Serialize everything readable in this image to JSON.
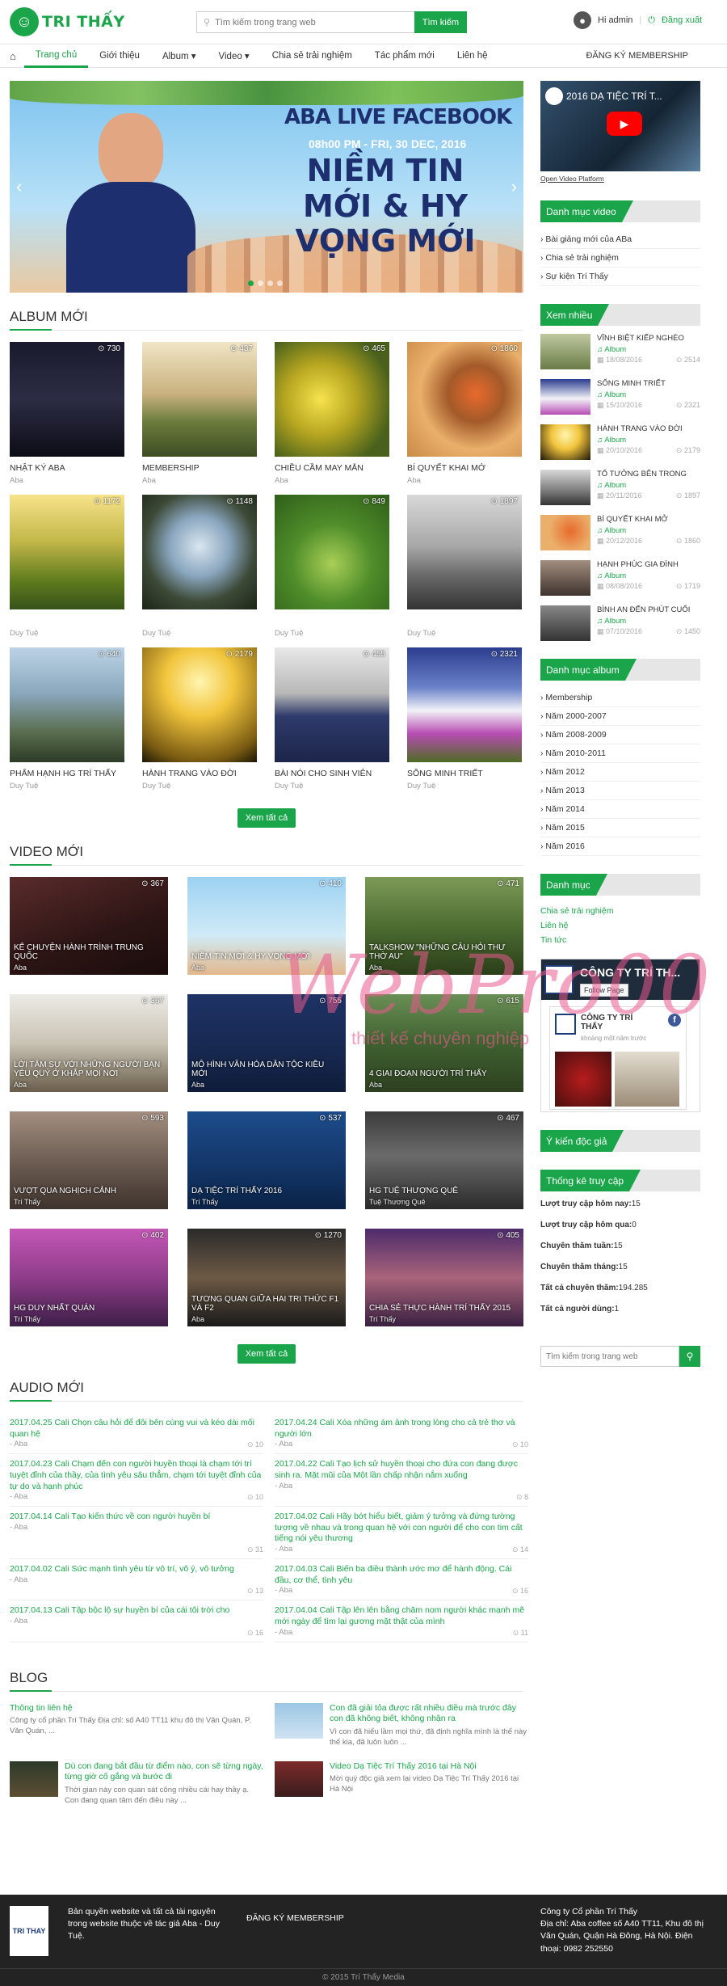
{
  "header": {
    "logo_text": "TRI THẤY",
    "search_placeholder": "Tìm kiếm trong trang web",
    "search_button": "Tìm kiếm",
    "user_greeting": "Hi admin",
    "separator": "|",
    "logout": "Đăng xuất"
  },
  "nav": {
    "items": [
      "Trang chủ",
      "Giới thiệu",
      "Album ▾",
      "Video ▾",
      "Chia sẻ trải nghiệm",
      "Tác phẩm mới",
      "Liên hệ"
    ],
    "membership": "ĐĂNG KÝ MEMBERSHIP"
  },
  "banner": {
    "title1": "ABA LIVE FACEBOOK",
    "title2": "08h00 PM - FRI, 30 DEC, 2016",
    "title3": "NIỀM TIN MỚI & HY VỌNG MỚI"
  },
  "albums": {
    "title": "ALBUM MỚI",
    "items": [
      {
        "name": "NHẬT KÝ ABA",
        "author": "Aba",
        "views": "730",
        "bg": "linear-gradient(180deg,#1a1a2e,#2c2c44 50%,#0d0d16)"
      },
      {
        "name": "MEMBERSHIP",
        "author": "Aba",
        "views": "437",
        "bg": "linear-gradient(180deg,#f0e5c6,#c9b27f 45%,#6a7b3c 70%,#3f4d23)"
      },
      {
        "name": "CHIỀU CẦM MAY MẮN",
        "author": "Aba",
        "views": "465",
        "bg": "radial-gradient(circle at 40% 50%,#f7e34d,#b6a520 40%,#49611c 80%)"
      },
      {
        "name": "BÍ QUYẾT KHAI MỞ",
        "author": "Aba",
        "views": "1860",
        "bg": "radial-gradient(circle at 60% 45%,#e86a2d,#a35a29 30%,#eab06b 60%,#c98a46)"
      },
      {
        "name": "",
        "author": "Duy Tuệ",
        "views": "1172",
        "bg": "linear-gradient(180deg,#f7e38a,#c4b84a 40%,#5f7c1d 75%,#37521a)"
      },
      {
        "name": "",
        "author": "Duy Tuệ",
        "views": "1148",
        "bg": "radial-gradient(circle at 50% 45%,#d9e6ef,#8aa6bf 35%,#3d4a38 65%,#1c2516)"
      },
      {
        "name": "",
        "author": "Duy Tuệ",
        "views": "849",
        "bg": "radial-gradient(circle at 50% 60%,#a9cf57,#4f8d2a 45%,#2e5e19)"
      },
      {
        "name": "",
        "author": "Duy Tuệ",
        "views": "1897",
        "bg": "linear-gradient(180deg,#d9d9d9,#a7a7a7 45%,#6a6a6a 70%,#333)"
      },
      {
        "name": "PHẨM HẠNH HG TRÍ THẤY",
        "author": "Duy Tuệ",
        "views": "640",
        "bg": "linear-gradient(180deg,#bcd3e6,#8aa7bc 40%,#586b4c 75%,#2c3b27)"
      },
      {
        "name": "HÀNH TRANG VÀO ĐỜI",
        "author": "Duy Tuệ",
        "views": "2179",
        "bg": "radial-gradient(circle at 50% 30%,#fff5b0,#f2c53d 35%,#7a5b12 80%,#1c1606)"
      },
      {
        "name": "BÀI NÓI CHO SINH VIÊN",
        "author": "Duy Tuệ",
        "views": "455",
        "bg": "linear-gradient(180deg,#e8e8e8,#b8b8b8 40%,#2e3a6a 60%,#1c254a)"
      },
      {
        "name": "SỐNG MINH TRIẾT",
        "author": "Duy Tuệ",
        "views": "2321",
        "bg": "linear-gradient(180deg,#2b3d8f,#6b82c9 35%,#f2f2f7 55%,#b74db3 75%,#4f6b24)"
      }
    ],
    "view_all": "Xem tất cả"
  },
  "videos": {
    "title": "VIDEO MỚI",
    "items": [
      {
        "name": "KỂ CHUYỆN HÀNH TRÌNH TRUNG QUỐC",
        "author": "Aba",
        "views": "367",
        "bg": "linear-gradient(160deg,#5a2b2b,#2c1414 60%,#1a0c0c)"
      },
      {
        "name": "NIỀM TIN MỚI & HY VỌNG MỚI",
        "author": "Aba",
        "views": "410",
        "bg": "linear-gradient(180deg,#9dd2f2,#d0eaf7 60%,#e3b88c)"
      },
      {
        "name": "TALKSHOW \"NHỮNG CÂU HỎI THƯ THỜ AU\"",
        "author": "Aba",
        "views": "471",
        "bg": "linear-gradient(180deg,#7d9a58,#4d6d31 50%,#2a3e1a)"
      },
      {
        "name": "LỜI TÂM SỰ VỚI NHỮNG NGƯỜI BẠN YÊU QUÝ Ở KHẮP MỌI NƠI",
        "author": "Aba",
        "views": "367",
        "bg": "linear-gradient(180deg,#ecebe6,#c9c3b4 50%,#6a5e4b)"
      },
      {
        "name": "MÔ HÌNH VĂN HÓA DÂN TỘC KIỀU MỚI",
        "author": "Aba",
        "views": "755",
        "bg": "linear-gradient(180deg,#1e3365,#17284f 60%,#0f1c3a)"
      },
      {
        "name": "4 GIAI ĐOẠN NGƯỜI TRÍ THẤY",
        "author": "Aba",
        "views": "615",
        "bg": "linear-gradient(180deg,#6a8f55,#3f6130 50%,#2d4020)"
      },
      {
        "name": "VƯỢT QUA NGHỊCH CẢNH",
        "author": "Trí Thấy",
        "views": "593",
        "bg": "linear-gradient(180deg,#a38e80,#6a5a50 55%,#3e332d)"
      },
      {
        "name": "DẠ TIỆC TRÍ THẤY 2016",
        "author": "Trí Thấy",
        "views": "537",
        "bg": "linear-gradient(180deg,#1d4c8c,#123566 60%,#0b2246)"
      },
      {
        "name": "HG Tuệ Thượng Quê",
        "author": "Tuệ Thương Quê",
        "views": "467",
        "bg": "linear-gradient(180deg,#3b3b3b,#6b6b6b 45%,#2a2a2a)"
      },
      {
        "name": "HG Duy Nhất Quán",
        "author": "Trí Thấy",
        "views": "402",
        "bg": "linear-gradient(180deg,#c457b6,#8f3d8a 50%,#3e1f48)"
      },
      {
        "name": "Tương quan giữa hai tri thức F1 và F2",
        "author": "Aba",
        "views": "1270",
        "bg": "linear-gradient(180deg,#2a2a2a,#6d5a45 50%,#1a1a1a)"
      },
      {
        "name": "Chia sẻ thực hành Trí Thấy 2015",
        "author": "Trí Thấy",
        "views": "405",
        "bg": "linear-gradient(180deg,#4d2b6b,#a9647a 50%,#3a2042)"
      }
    ],
    "view_all": "Xem tất cả"
  },
  "audio": {
    "title": "AUDIO MỚI",
    "items": [
      {
        "title": "2017.04.25 Cali Chọn câu hỏi để đôi bên cùng vui và kéo dài mối quan hệ",
        "author": "- Aba",
        "count": "10"
      },
      {
        "title": "2017.04.24 Cali Xóa những ám ảnh trong lòng cho cả trẻ thơ và người lớn",
        "author": "- Aba",
        "count": "10"
      },
      {
        "title": "2017.04.23 Cali Chạm đến con người huyền thoại là chạm tới trí tuyệt đỉnh của thầy, của tình yêu sâu thẳm, chạm tới tuyệt đỉnh của tự do và hạnh phúc",
        "author": "- Aba",
        "count": "10"
      },
      {
        "title": "2017.04.22 Cali Tạo lịch sử huyền thoại cho đứa con đang được sinh ra. Mặt mũi của Một lần chấp nhận nắm xuống",
        "author": "- Aba",
        "count": "8"
      },
      {
        "title": "2017.04.14 Cali Tạo kiến thức về con người huyền bí",
        "author": "- Aba",
        "count": "31"
      },
      {
        "title": "2017.04.02 Cali Hãy bớt hiểu biết, giảm ý tưởng và đứng tường tượng về nhau và trong quan hệ với con người để cho con tim cất tiếng nói yêu thương",
        "author": "- Aba",
        "count": "14"
      },
      {
        "title": "2017.04.02 Cali Sức mạnh tình yêu từ vô trí, vô ý, vô tưởng",
        "author": "- Aba",
        "count": "13"
      },
      {
        "title": "2017.04.03 Cali Biến ba điều thành ước mơ để hành động. Cái đầu, cơ thể, tình yêu",
        "author": "- Aba",
        "count": "16"
      },
      {
        "title": "2017.04.13 Cali Tập bộc lộ sự huyền bí của cái tôi trời cho",
        "author": "- Aba",
        "count": "16"
      },
      {
        "title": "2017.04.04 Cali Tập lên lên bằng chăm nom người khác mạnh mẽ mới ngày để tìm lại gương mặt thật của mình",
        "author": "- Aba",
        "count": "11"
      }
    ]
  },
  "blog": {
    "title": "BLOG",
    "items": [
      {
        "title": "Thông tin liên hệ",
        "desc": "Công ty cổ phần Trí Thấy Địa chỉ: số A40 TT11 khu đô thị Văn Quán, P. Văn Quán, ...",
        "img": ""
      },
      {
        "title": "Con đã giải tỏa được rất nhiều điều mà trước đây con đã không biết, không nhận ra",
        "desc": "Vì con đã hiểu lầm mọi thứ, đã định nghĩa mình là thế này thế kia, đã luôn luôn ...",
        "img": "linear-gradient(180deg,#9cc6e4,#cfe3f2)"
      },
      {
        "title": "Dù con đang bắt đầu từ điểm nào, con sẽ từng ngày, từng giờ cố gắng và bước đi",
        "desc": "Thời gian này con quan sát công nhiều cái hay thầy ạ. Con đang quan tâm đến điều này ...",
        "img": "linear-gradient(180deg,#2d3a2a,#5d4f33)"
      },
      {
        "title": "Video Dạ Tiệc Trí Thấy 2016 tại Hà Nội",
        "desc": "Mời quý độc giả xem lại video Dạ Tiệc Trí Thấy 2016 tại Hà Nội",
        "img": "linear-gradient(180deg,#7d2b2b,#3a1d1d)"
      }
    ]
  },
  "sidebar": {
    "youtube_title": "2016 DẠ TIỆC TRÍ T...",
    "youtube_link": "Open Video Platform",
    "video_cat_title": "Danh mục video",
    "video_cats": [
      "Bài giảng mới của ABa",
      "Chia sẻ trải nghiệm",
      "Sự kiện Trí Thấy"
    ],
    "popular_title": "Xem nhiều",
    "popular": [
      {
        "title": "VĨNH BIỆT KIẾP NGHÈO",
        "cat": "Album",
        "date": "18/08/2016",
        "views": "2514",
        "img": "linear-gradient(180deg,#bfc9a0,#6a7c47)"
      },
      {
        "title": "SỐNG MINH TRIẾT",
        "cat": "Album",
        "date": "15/10/2016",
        "views": "2321",
        "img": "linear-gradient(180deg,#2b3d8f,#f2f2f7 55%,#b74db3)"
      },
      {
        "title": "HÀNH TRANG VÀO ĐỜI",
        "cat": "Album",
        "date": "20/10/2016",
        "views": "2179",
        "img": "radial-gradient(circle at 50% 30%,#fff5b0,#f2c53d 40%,#1c1606)"
      },
      {
        "title": "TỔ TƯỞNG BÊN TRONG",
        "cat": "Album",
        "date": "20/11/2016",
        "views": "1897",
        "img": "linear-gradient(180deg,#d9d9d9,#6a6a6a 70%,#333)"
      },
      {
        "title": "BÍ QUYẾT KHAI MỞ",
        "cat": "Album",
        "date": "20/12/2016",
        "views": "1860",
        "img": "radial-gradient(circle at 60% 45%,#e86a2d,#eab06b 60%)"
      },
      {
        "title": "HẠNH PHÚC GIA ĐÌNH",
        "cat": "Album",
        "date": "08/08/2016",
        "views": "1719",
        "img": "linear-gradient(180deg,#a38e80,#3e332d)"
      },
      {
        "title": "BÌNH AN ĐẾN PHÚT CUỐI",
        "cat": "Album",
        "date": "07/10/2016",
        "views": "1450",
        "img": "linear-gradient(180deg,#888,#333)"
      }
    ],
    "album_cat_title": "Danh mục album",
    "album_cats": [
      "Membership",
      "Năm 2000-2007",
      "Năm 2008-2009",
      "Năm 2010-2011",
      "Năm 2012",
      "Năm 2013",
      "Năm 2014",
      "Năm 2015",
      "Năm 2016"
    ],
    "cat_title": "Danh mục",
    "cats": [
      "Chia sẻ trải nghiệm",
      "Liên hệ",
      "Tin tức"
    ],
    "fb_name": "CÔNG TY TRÍ TH...",
    "fb_follow": "Follow Page",
    "fb_card_name": "CÔNG TY TRÍ THẤY",
    "fb_card_sub": "khoảng một năm trước",
    "opinion_title": "Ý kiến độc giả",
    "stats_title": "Thống kê truy cập",
    "stats": [
      {
        "label": "Lượt truy cập hôm nay:",
        "value": "15"
      },
      {
        "label": "Lượt truy cập hôm qua:",
        "value": "0"
      },
      {
        "label": "Chuyên thăm tuần:",
        "value": "15"
      },
      {
        "label": "Chuyên thăm tháng:",
        "value": "15"
      },
      {
        "label": "Tất cả chuyên thăm:",
        "value": "194.285"
      },
      {
        "label": "Tất cả người dùng:",
        "value": "1"
      }
    ],
    "search_placeholder": "Tìm kiếm trong trang web"
  },
  "footer": {
    "copyright_text": "Bản quyền website và tất cả tài nguyên trong website thuộc về tác giả Aba - Duy Tuệ.",
    "membership": "ĐĂNG KÝ MEMBERSHIP",
    "company": "Công ty Cổ phần Trí Thấy",
    "address": "Địa chỉ: Aba coffee số A40 TT11, Khu đô thị Văn Quán, Quận Hà Đông, Hà Nội. Điện thoại: 0982 252550",
    "bottom": "© 2015 Trí Thấy Media"
  },
  "watermark": {
    "text": "WebPro00",
    "sub": "thiết kế chuyên nghiệp"
  },
  "colors": {
    "accent": "#1aa54a"
  }
}
